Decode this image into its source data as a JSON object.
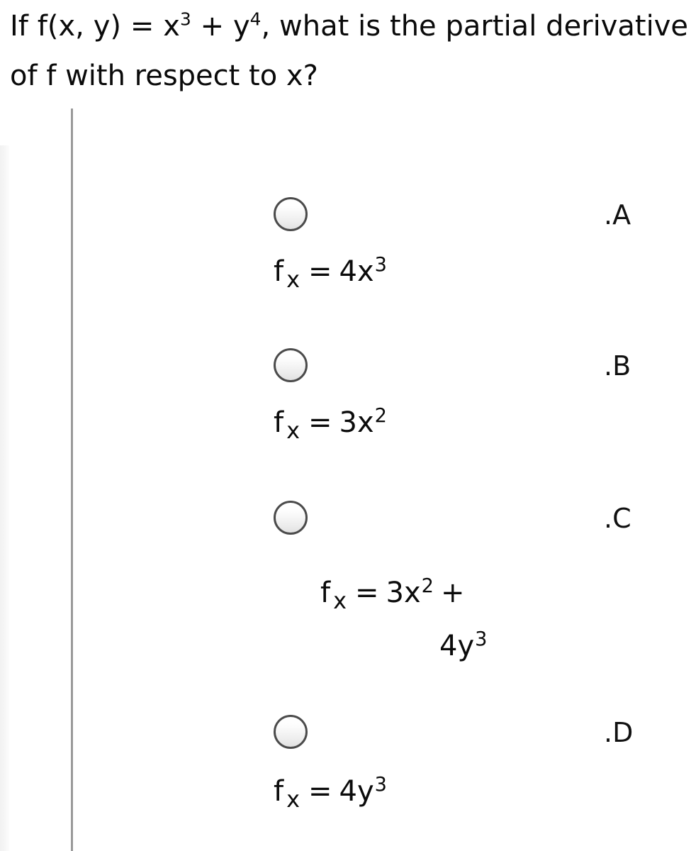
{
  "question": {
    "text_before_sup1": "If f(x, y) = x",
    "sup1": "3",
    "text_mid": " + y",
    "sup2": "4",
    "text_after": ", what is the partial derivative of f with respect to x?",
    "full_text": "If f(x, y) = x3 + y4, what is the partial derivative of f with respect to x?"
  },
  "options": [
    {
      "letter": ".A",
      "formula_plain": "f x = 4x3",
      "lhs": "f",
      "sub": "x",
      "eq": "=",
      "rhs_base": "4x",
      "rhs_sup": "3",
      "selected": false
    },
    {
      "letter": ".B",
      "formula_plain": "f x = 3x2",
      "lhs": "f",
      "sub": "x",
      "eq": "=",
      "rhs_base": "3x",
      "rhs_sup": "2",
      "selected": false
    },
    {
      "letter": ".C",
      "formula_plain": "f x = 3x2 + 4y3",
      "lhs": "f",
      "sub": "x",
      "eq": "=",
      "rhs_base": "3x",
      "rhs_sup": "2",
      "plus": "+",
      "cont_base": "4y",
      "cont_sup": "3",
      "selected": false
    },
    {
      "letter": ".D",
      "formula_plain": "f x = 4y3",
      "lhs": "f",
      "sub": "x",
      "eq": "=",
      "rhs_base": "4y",
      "rhs_sup": "3",
      "selected": false
    }
  ],
  "colors": {
    "text": "#0a0a0a",
    "rule": "#9a9a9a",
    "radio_border": "#4b4b4b",
    "radio_fill_top": "#ffffff",
    "radio_fill_bottom": "#e2e2e2",
    "page_background": "#ffffff",
    "edge_strip": "#f4f4f4"
  }
}
